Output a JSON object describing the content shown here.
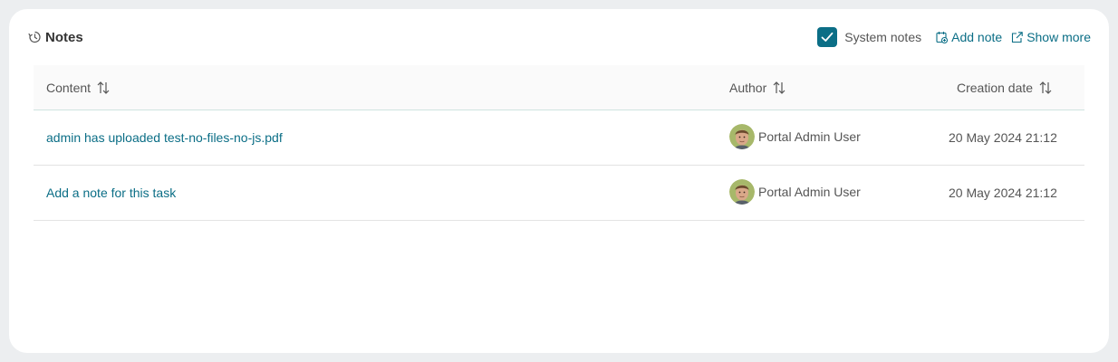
{
  "panel": {
    "title": "Notes",
    "title_icon": "history-icon"
  },
  "actions": {
    "system_notes_label": "System notes",
    "system_notes_checked": true,
    "add_note_label": "Add note",
    "show_more_label": "Show more"
  },
  "table": {
    "columns": [
      "Content",
      "Author",
      "Creation date"
    ],
    "rows": [
      {
        "content": "admin has uploaded test-no-files-no-js.pdf",
        "author": "Portal Admin User",
        "date": "20 May 2024 21:12"
      },
      {
        "content": "Add a note for this task",
        "author": "Portal Admin User",
        "date": "20 May 2024 21:12"
      }
    ]
  },
  "colors": {
    "accent": "#0b6e86",
    "background": "#eceef0"
  }
}
